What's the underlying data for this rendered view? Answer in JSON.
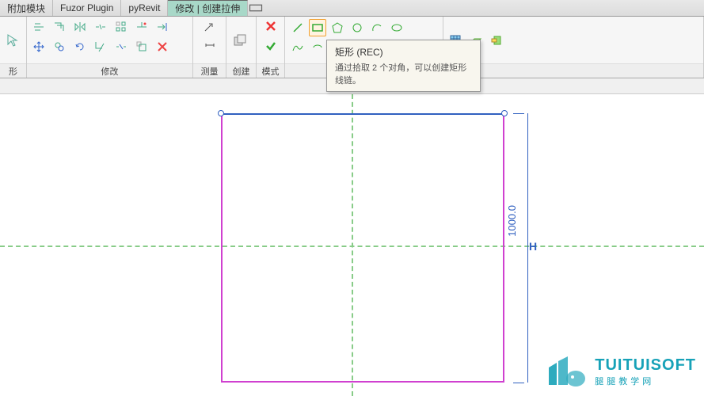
{
  "tabs": {
    "addon": "附加模块",
    "fuzor": "Fuzor Plugin",
    "pyrevit": "pyRevit",
    "modify": "修改 | 创建拉伸"
  },
  "groups": {
    "shape": "形",
    "modify": "修改",
    "measure": "测量",
    "create": "创建",
    "mode": "模式"
  },
  "tooltip": {
    "title": "矩形 (REC)",
    "body": "通过拾取 2 个对角，可以创建矩形线链。"
  },
  "canvas": {
    "dimension": "1000.0",
    "handle": "H"
  },
  "watermark": {
    "title": "TUITUISOFT",
    "sub": "腿腿教学网"
  }
}
